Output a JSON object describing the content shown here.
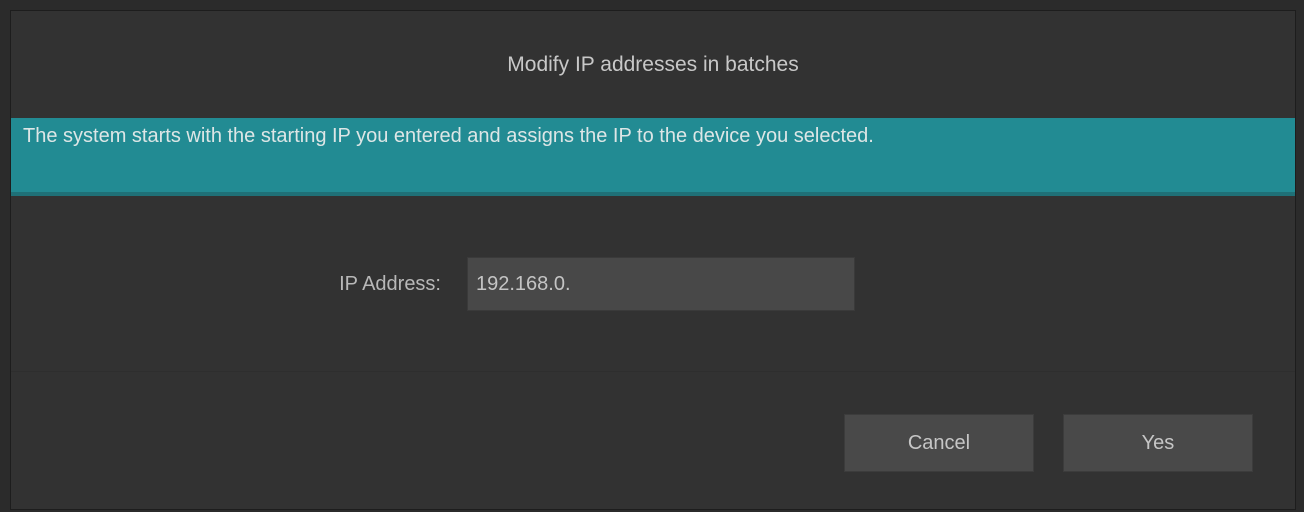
{
  "dialog": {
    "title": "Modify IP addresses in batches",
    "notice": "The system starts with the starting IP you entered and assigns the IP to the device you selected.",
    "ip_label": "IP Address:",
    "ip_value": "192.168.0.",
    "cancel_label": "Cancel",
    "yes_label": "Yes"
  },
  "colors": {
    "background": "#323232",
    "notice_banner": "#228b93",
    "input_background": "#484848",
    "button_background": "#494949",
    "text": "#c8c8c8"
  }
}
